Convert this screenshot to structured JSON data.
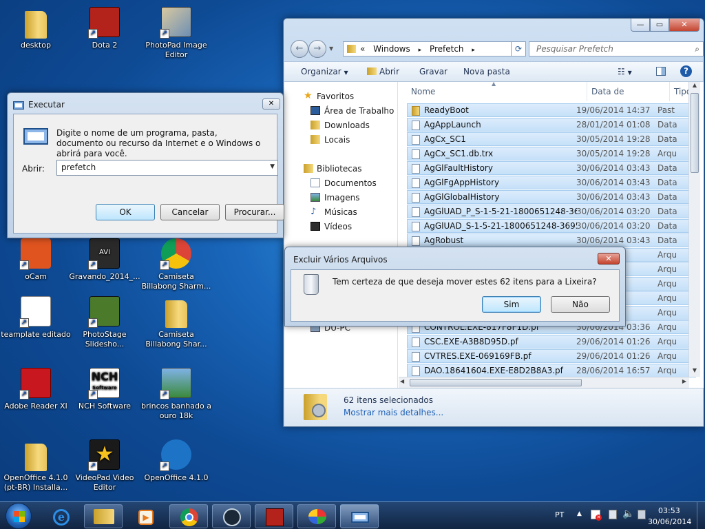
{
  "desktop": {
    "icons": [
      {
        "label": "desktop"
      },
      {
        "label": "Dota 2"
      },
      {
        "label": "PhotoPad Image Editor"
      },
      {
        "label": "oCam"
      },
      {
        "label": "Gravando_2014_..."
      },
      {
        "label": "Camiseta Billabong Sharm..."
      },
      {
        "label": "teamplate editado"
      },
      {
        "label": "PhotoStage Slidesho..."
      },
      {
        "label": "Camiseta Billabong Shar..."
      },
      {
        "label": "Adobe Reader XI"
      },
      {
        "label": "NCH Software"
      },
      {
        "label": "brincos banhado a ouro 18k"
      },
      {
        "label": "OpenOffice 4.1.0 (pt-BR) Installa..."
      },
      {
        "label": "VideoPad Video Editor"
      },
      {
        "label": "OpenOffice 4.1.0"
      }
    ],
    "avi_badge": "AVI",
    "nch_badge": "NCH",
    "nch_sub": "Software"
  },
  "explorer": {
    "breadcrumb": {
      "prefix": "«",
      "part1": "Windows",
      "sep": "▸",
      "part2": "Prefetch"
    },
    "search_placeholder": "Pesquisar Prefetch",
    "toolbar": {
      "organize": "Organizar",
      "open": "Abrir",
      "burn": "Gravar",
      "new_folder": "Nova pasta"
    },
    "nav": {
      "favorites": "Favoritos",
      "desktop": "Área de Trabalho",
      "downloads": "Downloads",
      "places": "Locais",
      "libraries": "Bibliotecas",
      "documents": "Documentos",
      "images": "Imagens",
      "music": "Músicas",
      "videos": "Vídeos",
      "computer": "DU-PC"
    },
    "columns": {
      "name": "Nome",
      "date": "Data de modificaç...",
      "type": "Tipo"
    },
    "files": [
      {
        "name": "ReadyBoot",
        "date": "19/06/2014 14:37",
        "type": "Past",
        "kind": "folder"
      },
      {
        "name": "AgAppLaunch",
        "date": "28/01/2014 01:08",
        "type": "Data",
        "kind": "file"
      },
      {
        "name": "AgCx_SC1",
        "date": "30/05/2014 19:28",
        "type": "Data",
        "kind": "file"
      },
      {
        "name": "AgCx_SC1.db.trx",
        "date": "30/05/2014 19:28",
        "type": "Arqu",
        "kind": "file"
      },
      {
        "name": "AgGlFaultHistory",
        "date": "30/06/2014 03:43",
        "type": "Data",
        "kind": "file"
      },
      {
        "name": "AgGlFgAppHistory",
        "date": "30/06/2014 03:43",
        "type": "Data",
        "kind": "file"
      },
      {
        "name": "AgGlGlobalHistory",
        "date": "30/06/2014 03:43",
        "type": "Data",
        "kind": "file"
      },
      {
        "name": "AgGlUAD_P_S-1-5-21-1800651248-36952...",
        "date": "30/06/2014 03:20",
        "type": "Data",
        "kind": "file"
      },
      {
        "name": "AgGlUAD_S-1-5-21-1800651248-3695209...",
        "date": "30/06/2014 03:20",
        "type": "Data",
        "kind": "file"
      },
      {
        "name": "AgRobust",
        "date": "30/06/2014 03:43",
        "type": "Data",
        "kind": "file"
      },
      {
        "name": "",
        "date": "3:27",
        "type": "Arqu",
        "kind": "file"
      },
      {
        "name": "",
        "date": "3:30",
        "type": "Arqu",
        "kind": "file"
      },
      {
        "name": "",
        "date": "20:24",
        "type": "Arqu",
        "kind": "file"
      },
      {
        "name": "",
        "date": "3:27",
        "type": "Arqu",
        "kind": "file"
      },
      {
        "name": "",
        "date": "3:49",
        "type": "Arqu",
        "kind": "file"
      },
      {
        "name": "CONTROL.EXE-817F8F1D.pf",
        "date": "30/06/2014 03:36",
        "type": "Arqu",
        "kind": "file"
      },
      {
        "name": "CSC.EXE-A3B8D95D.pf",
        "date": "29/06/2014 01:26",
        "type": "Arqu",
        "kind": "file"
      },
      {
        "name": "CVTRES.EXE-069169FB.pf",
        "date": "29/06/2014 01:26",
        "type": "Arqu",
        "kind": "file"
      },
      {
        "name": "DAO.18641604.EXE-E8D2B8A3.pf",
        "date": "28/06/2014 16:57",
        "type": "Arqu",
        "kind": "file"
      }
    ],
    "details": {
      "count": "62 itens selecionados",
      "more": "Mostrar mais detalhes..."
    }
  },
  "run_dialog": {
    "title": "Executar",
    "message": "Digite o nome de um programa, pasta, documento ou recurso da Internet e o Windows o abrirá para você.",
    "label": "Abrir:",
    "value": "prefetch",
    "ok": "OK",
    "cancel": "Cancelar",
    "browse": "Procurar..."
  },
  "delete_dialog": {
    "title": "Excluir Vários Arquivos",
    "message": "Tem certeza de que deseja mover estes 62 itens para a Lixeira?",
    "yes": "Sim",
    "no": "Não"
  },
  "taskbar": {
    "lang": "PT",
    "time": "03:53",
    "date": "30/06/2014"
  },
  "colors": {
    "accent": "#3399ff",
    "close_red": "#c4442f",
    "link": "#1b5eb5"
  }
}
